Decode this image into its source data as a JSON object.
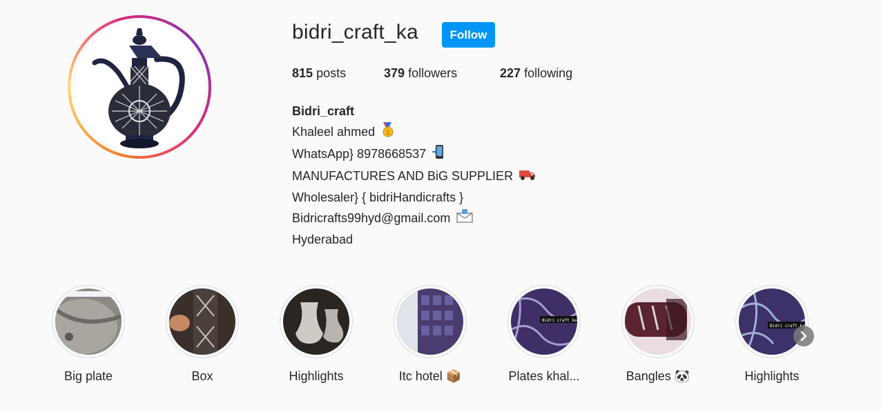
{
  "profile": {
    "username": "bidri_craft_ka",
    "follow_label": "Follow",
    "stats": {
      "posts_count": "815",
      "posts_label": "posts",
      "followers_count": "379",
      "followers_label": "followers",
      "following_count": "227",
      "following_label": "following"
    },
    "bio": {
      "name": "Bidri_craft",
      "line1": "Khaleel ahmed",
      "line2": "WhatsApp} 8978668537",
      "line3": "MANUFACTURES AND BiG SUPPLIER",
      "line4": "Wholesaler} { bidriHandicrafts }",
      "line5": "Bidricrafts99hyd@gmail.com",
      "line6": "Hyderabad"
    },
    "bio_icons": [
      "medal-icon",
      "mobile-phone-icon",
      "truck-icon",
      "envelope-icon"
    ]
  },
  "highlights": [
    {
      "label": "Big plate"
    },
    {
      "label": "Box"
    },
    {
      "label": "Highlights"
    },
    {
      "label": "Itc hotel 📦"
    },
    {
      "label": "Plates khal..."
    },
    {
      "label": "Bangles 🐼"
    },
    {
      "label": "Highlights"
    }
  ],
  "watermark_text": "Bidri craft ka",
  "colors": {
    "follow_button": "#0095f6",
    "background": "#fafafa",
    "text": "#262626"
  }
}
